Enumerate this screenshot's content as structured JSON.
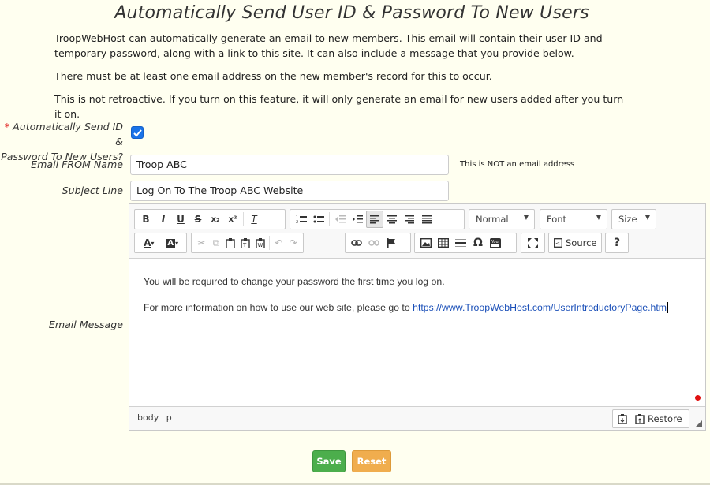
{
  "page": {
    "title": "Automatically Send User ID & Password To New Users",
    "paragraphs": [
      "TroopWebHost can automatically generate an email to new members. This email will contain their user ID and temporary password, along with a link to this site. It can also include a message that you provide below.",
      "There must be at least one email address on the new member's record for this to occur.",
      "This is not retroactive. If you turn on this feature, it will only generate an email for new users added after you turn it on."
    ]
  },
  "form": {
    "auto_send": {
      "required_mark": "*",
      "label_line1": "Automatically Send ID &",
      "label_line2": "Password To New Users?",
      "checked": true
    },
    "from_name": {
      "label": "Email FROM Name",
      "value": "Troop ABC",
      "hint": "This is NOT an email address"
    },
    "subject": {
      "label": "Subject Line",
      "value": "Log On To The Troop ABC Website"
    },
    "message": {
      "label": "Email Message"
    }
  },
  "editor": {
    "format_combo": "Normal",
    "font_combo": "Font",
    "size_combo": "Size",
    "source_label": "Source",
    "help_label": "?",
    "content": {
      "line1": "You will be required to change your password the first time you log on.",
      "line2_prefix": "For more information on how to use our ",
      "line2_link": "web site",
      "line2_middle": ", please go to ",
      "line2_url": "https://www.TroopWebHost.com/UserIntroductoryPage.htm"
    },
    "statusbar": {
      "path": [
        "body",
        "p"
      ],
      "restore_label": "Restore"
    }
  },
  "actions": {
    "save_label": "Save",
    "reset_label": "Reset",
    "save_color": "#4cae4c",
    "reset_color": "#f0ad4e"
  }
}
